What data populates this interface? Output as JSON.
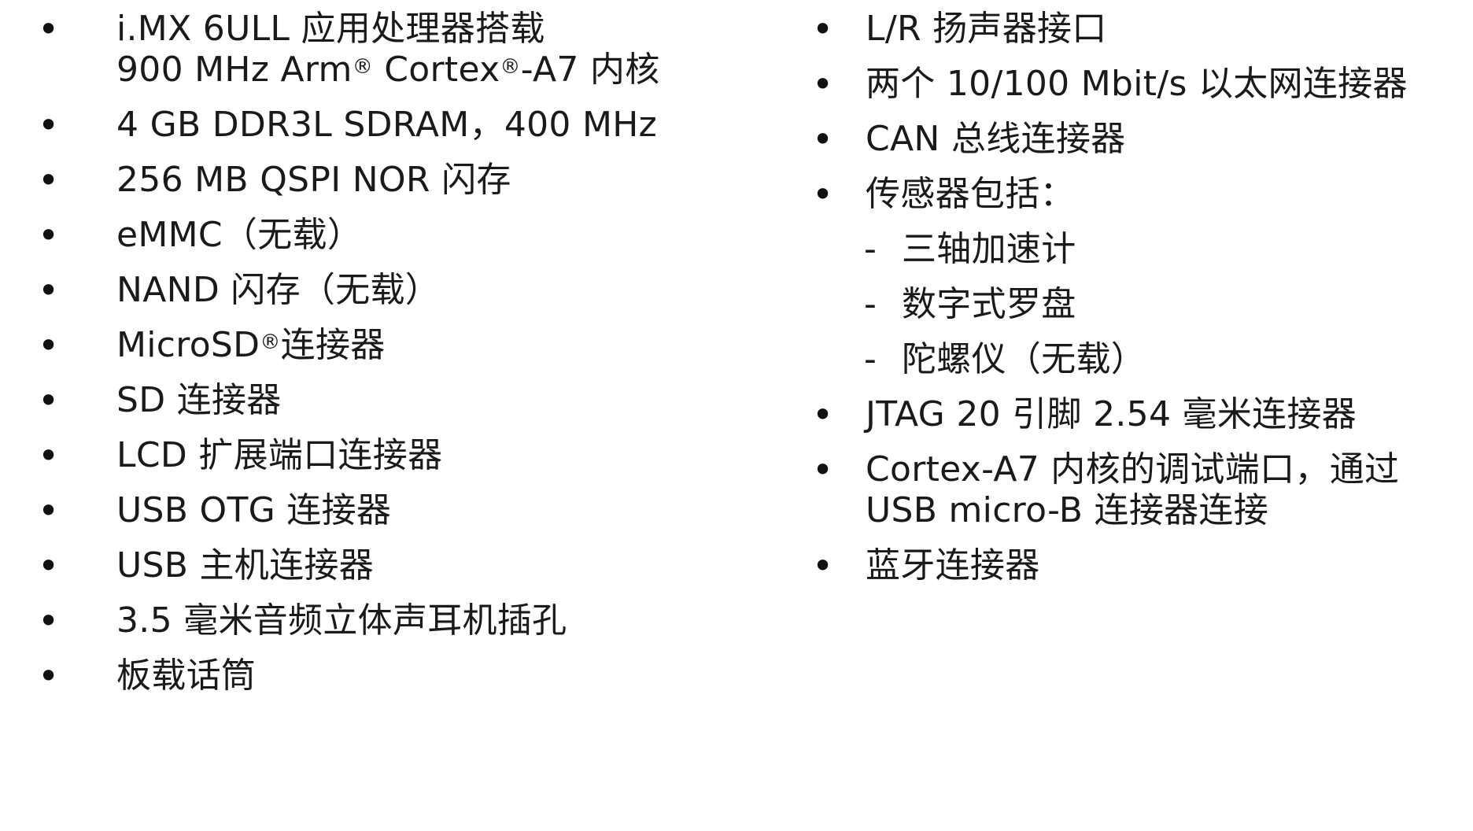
{
  "left_list": [
    {
      "lines": [
        "i.MX 6ULL 应用处理器搭载",
        "900 MHz Arm® Cortex®-A7 内核"
      ]
    },
    {
      "lines": [
        "4 GB DDR3L SDRAM，400 MHz"
      ]
    },
    {
      "lines": [
        "256 MB QSPI NOR 闪存"
      ]
    },
    {
      "lines": [
        "eMMC（无载）"
      ]
    },
    {
      "lines": [
        "NAND 闪存（无载）"
      ]
    },
    {
      "lines": [
        "MicroSD®连接器"
      ]
    },
    {
      "lines": [
        "SD 连接器"
      ]
    },
    {
      "lines": [
        "LCD 扩展端口连接器"
      ]
    },
    {
      "lines": [
        "USB OTG 连接器"
      ]
    },
    {
      "lines": [
        "USB 主机连接器"
      ]
    },
    {
      "lines": [
        "3.5 毫米音频立体声耳机插孔"
      ]
    },
    {
      "lines": [
        "板载话筒"
      ]
    }
  ],
  "right_list": [
    {
      "lines": [
        "L/R 扬声器接口"
      ]
    },
    {
      "lines": [
        "两个 10/100 Mbit/s 以太网连接器"
      ]
    },
    {
      "lines": [
        "CAN 总线连接器"
      ]
    },
    {
      "lines": [
        "传感器包括："
      ],
      "sub_items": [
        "三轴加速计",
        "数字式罗盘",
        "陀螺仪（无载）"
      ]
    },
    {
      "lines": [
        "JTAG 20 引脚 2.54 毫米连接器"
      ]
    },
    {
      "lines": [
        "Cortex-A7 内核的调试端口，通过",
        "USB micro-B 连接器连接"
      ]
    },
    {
      "lines": [
        "蓝牙连接器"
      ]
    }
  ],
  "bullet_symbol": "•",
  "sub_bullet_symbol": "-",
  "text_color": "#1a1a1a"
}
